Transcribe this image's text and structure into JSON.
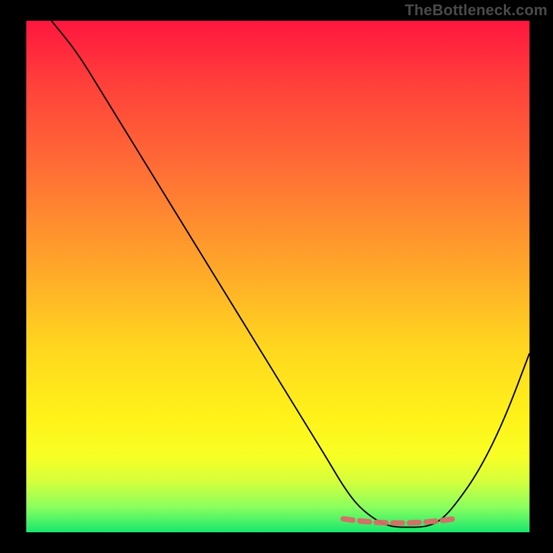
{
  "watermark": "TheBottleneck.com",
  "colors": {
    "frame": "#000000",
    "gradient_top": "#ff163f",
    "gradient_bottom": "#18e76e",
    "curve": "#000000",
    "low_marker": "#d86a68"
  },
  "chart_data": {
    "type": "line",
    "title": "",
    "xlabel": "",
    "ylabel": "",
    "xlim": [
      0,
      100
    ],
    "ylim": [
      0,
      100
    ],
    "series": [
      {
        "name": "bottleneck-curve",
        "x": [
          5,
          10,
          15,
          20,
          25,
          30,
          35,
          40,
          45,
          50,
          55,
          60,
          63,
          66,
          70,
          73,
          76,
          79,
          82,
          85,
          90,
          95,
          100
        ],
        "values": [
          100,
          94,
          86,
          78,
          70,
          62,
          54,
          46,
          38,
          30,
          22,
          14,
          9,
          5,
          2,
          1,
          1,
          1,
          2,
          5,
          12,
          22,
          35
        ]
      }
    ],
    "annotations": [
      {
        "name": "low-bottleneck-zone",
        "x_range": [
          63,
          85
        ],
        "y_approx": 1
      }
    ]
  }
}
